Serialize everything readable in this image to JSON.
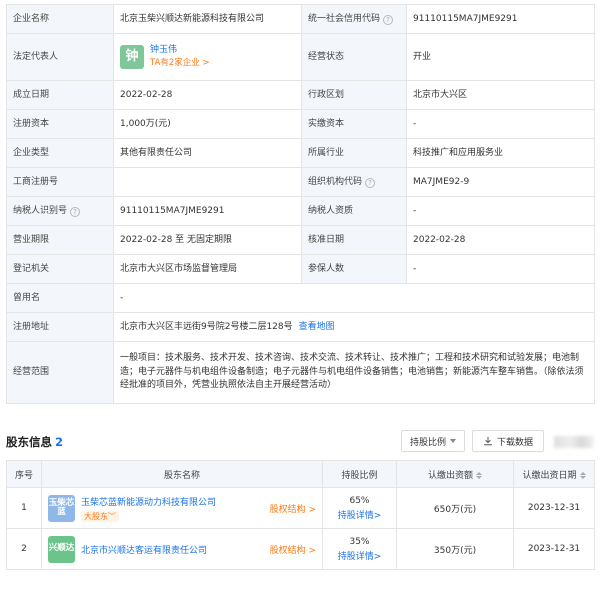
{
  "info": {
    "company_name_label": "企业名称",
    "company_name": "北京玉柴兴顺达新能源科技有限公司",
    "credit_code_label": "统一社会信用代码",
    "credit_code": "91110115MA7JME9291",
    "legal_rep_label": "法定代表人",
    "legal_rep_avatar": "钟",
    "legal_rep_name": "钟玉伟",
    "legal_rep_sub": "TA有2家企业 >",
    "status_label": "经营状态",
    "status": "开业",
    "founded_label": "成立日期",
    "founded": "2022-02-28",
    "region_label": "行政区划",
    "region": "北京市大兴区",
    "capital_label": "注册资本",
    "capital": "1,000万(元)",
    "paid_label": "实缴资本",
    "paid": "-",
    "type_label": "企业类型",
    "type": "其他有限责任公司",
    "industry_label": "所属行业",
    "industry": "科技推广和应用服务业",
    "reg_no_label": "工商注册号",
    "reg_no": "",
    "org_code_label": "组织机构代码",
    "org_code": "MA7JME92-9",
    "taxpayer_id_label": "纳税人识别号",
    "taxpayer_id": "91110115MA7JME9291",
    "taxpayer_qual_label": "纳税人资质",
    "taxpayer_qual": "-",
    "term_label": "营业期限",
    "term": "2022-02-28 至 无固定期限",
    "approval_label": "核准日期",
    "approval": "2022-02-28",
    "authority_label": "登记机关",
    "authority": "北京市大兴区市场监督管理局",
    "insured_label": "参保人数",
    "insured": "-",
    "former_name_label": "曾用名",
    "former_name": "-",
    "address_label": "注册地址",
    "address": "北京市大兴区丰远街9号院2号楼二层128号",
    "map_link": "查看地图",
    "scope_label": "经营范围",
    "scope": "一般项目：技术服务、技术开发、技术咨询、技术交流、技术转让、技术推广；工程和技术研究和试验发展；电池制造；电子元器件与机电组件设备制造；电子元器件与机电组件设备销售；电池销售；新能源汽车整车销售。（除依法须经批准的项目外，凭营业执照依法自主开展经营活动）"
  },
  "shareholders": {
    "title": "股东信息",
    "count": "2",
    "ratio_button": "持股比例",
    "download_button": "下载数据",
    "columns": {
      "index": "序号",
      "name": "股东名称",
      "ratio": "持股比例",
      "subscribed": "认缴出资额",
      "date": "认缴出资日期"
    },
    "rows": [
      {
        "index": "1",
        "logo": "玉柴芯蓝",
        "name": "玉柴芯蓝新能源动力科技有限公司",
        "tag": "大股东",
        "equity": "股权结构 >",
        "ratio": "65%",
        "detail": "持股详情>",
        "amount": "650万(元)",
        "date": "2023-12-31"
      },
      {
        "index": "2",
        "logo": "兴顺达",
        "name": "北京市兴顺达客运有限责任公司",
        "tag": "",
        "equity": "股权结构 >",
        "ratio": "35%",
        "detail": "持股详情>",
        "amount": "350万(元)",
        "date": "2023-12-31"
      }
    ]
  }
}
